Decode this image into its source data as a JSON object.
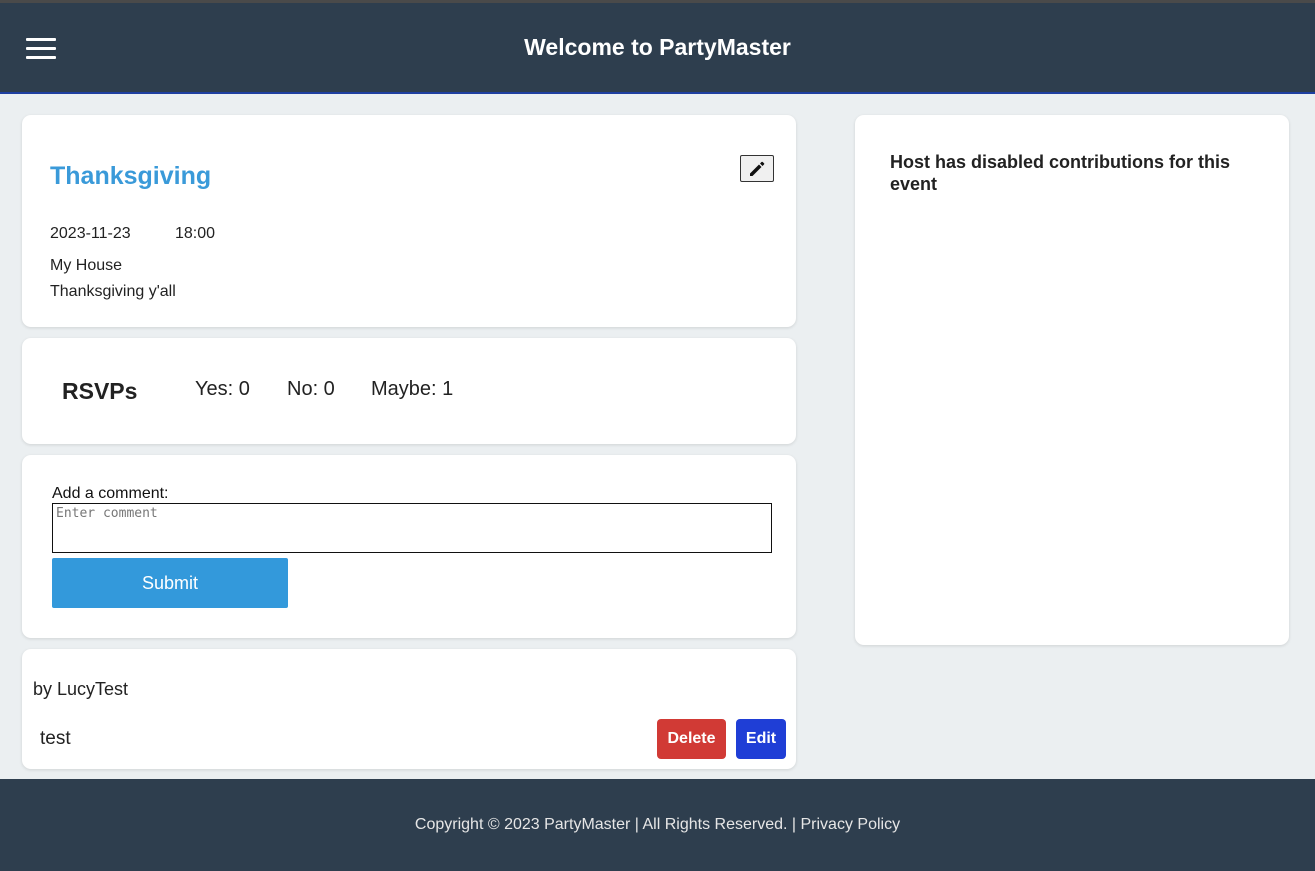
{
  "header": {
    "title": "Welcome to PartyMaster",
    "menu_icon": "hamburger-menu-icon"
  },
  "event": {
    "title": "Thanksgiving",
    "date": "2023-11-23",
    "time": "18:00",
    "location": "My House",
    "description": "Thanksgiving y'all",
    "edit_icon": "pencil-icon"
  },
  "rsvps": {
    "title": "RSVPs",
    "yes": "Yes: 0",
    "no": "No: 0",
    "maybe": "Maybe: 1"
  },
  "comment_form": {
    "label": "Add a comment:",
    "placeholder": "Enter comment",
    "value": "",
    "submit_label": "Submit"
  },
  "comments": [
    {
      "author": "by LucyTest",
      "text": "test",
      "delete_label": "Delete",
      "edit_label": "Edit"
    }
  ],
  "contributions": {
    "message": "Host has disabled contributions for this event"
  },
  "footer": {
    "copyright": "Copyright © 2023 PartyMaster | All Rights Reserved. | ",
    "privacy_label": "Privacy Policy"
  },
  "colors": {
    "header_bg": "#2e3e4e",
    "page_bg": "#ebeff1",
    "accent": "#3399db",
    "title_blue": "#3a9ad9",
    "delete_red": "#d13a35",
    "edit_blue": "#1f3ed6"
  }
}
